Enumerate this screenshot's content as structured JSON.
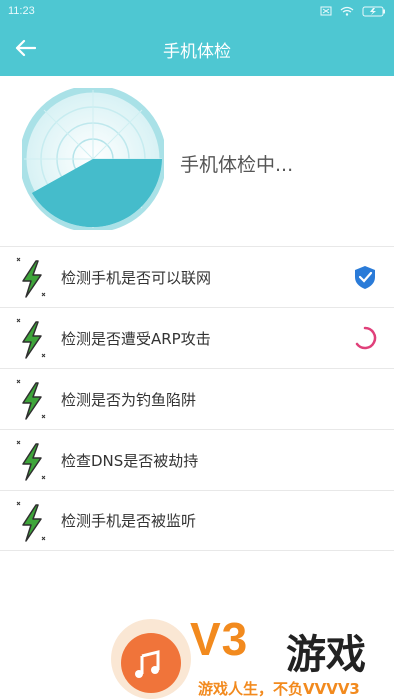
{
  "status_bar": {
    "time": "11:23"
  },
  "header": {
    "title": "手机体检"
  },
  "scan": {
    "status_text": "手机体检中..."
  },
  "checks": [
    {
      "label": "检测手机是否可以联网",
      "state": "done"
    },
    {
      "label": "检测是否遭受ARP攻击",
      "state": "loading"
    },
    {
      "label": "检测是否为钓鱼陷阱",
      "state": "pending"
    },
    {
      "label": "检查DNS是否被劫持",
      "state": "pending"
    },
    {
      "label": "检测手机是否被监听",
      "state": "pending"
    }
  ],
  "watermark": {
    "brand": "V3",
    "brand_cn": "游戏",
    "slogan": "游戏人生，不负VVVV3"
  },
  "colors": {
    "accent": "#4ec7d2",
    "icon_green": "#3ea53a",
    "progress": "#e0407a",
    "shield_blue": "#2a7bd8"
  }
}
